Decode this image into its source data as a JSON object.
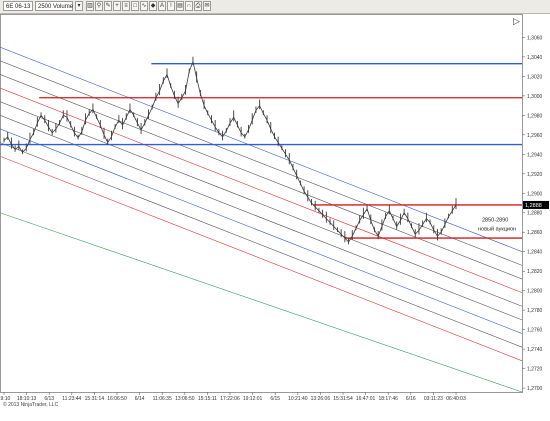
{
  "toolbar": {
    "instrument": "6E 06-13",
    "period": "2500 Volume",
    "icons": [
      "dropdown-icon",
      "chart-bar-icon",
      "zoom-icon",
      "draw-icon",
      "crosshair-icon",
      "properties-icon",
      "template-icon",
      "indicator-icon",
      "strategy-icon",
      "text-icon",
      "alert-icon",
      "data-box-icon",
      "magnet-icon",
      "print-icon",
      "email-icon",
      "expand-icon"
    ]
  },
  "copyright": "© 2013 NinjaTrader, LLC",
  "colors": {
    "price": "#3a3a3a",
    "blue_level": "#2d5fd8",
    "red_level": "#d61a1a",
    "channel_red": "#e03030",
    "channel_blue": "#3b5fc8",
    "channel_gray": "#555555",
    "channel_green": "#2f9a5a",
    "last_price_bg": "#000000"
  },
  "chart_data": {
    "type": "line",
    "series": [
      {
        "values": [
          1.2954,
          1.2958,
          1.295,
          1.2945,
          1.2948,
          1.2942,
          1.2946,
          1.2955,
          1.2962,
          1.2972,
          1.298,
          1.2975,
          1.2968,
          1.2962,
          1.2966,
          1.2972,
          1.298,
          1.2978,
          1.297,
          1.2962,
          1.2957,
          1.2963,
          1.2975,
          1.2982,
          1.2986,
          1.2978,
          1.297,
          1.296,
          1.2952,
          1.2958,
          1.2968,
          1.2975,
          1.297,
          1.2978,
          1.2986,
          1.298,
          1.2972,
          1.2965,
          1.2972,
          1.298,
          1.2988,
          1.2998,
          1.3005,
          1.3015,
          1.3022,
          1.301,
          1.3,
          1.2992,
          1.2998,
          1.3005,
          1.3025,
          1.3035,
          1.3018,
          1.3002,
          1.299,
          1.2982,
          1.2975,
          1.2968,
          1.2962,
          1.2958,
          1.2964,
          1.2972,
          1.2978,
          1.297,
          1.2962,
          1.2958,
          1.2965,
          1.2975,
          1.2985,
          1.299,
          1.2982,
          1.2975,
          1.2966,
          1.2958,
          1.2952,
          1.2946,
          1.294,
          1.2934,
          1.2926,
          1.2918,
          1.291,
          1.2902,
          1.2896,
          1.289,
          1.2886,
          1.2882,
          1.2878,
          1.2874,
          1.287,
          1.2866,
          1.2862,
          1.2858,
          1.2854,
          1.285,
          1.2856,
          1.2864,
          1.2872,
          1.2878,
          1.2884,
          1.2872,
          1.2862,
          1.2856,
          1.2866,
          1.2876,
          1.2882,
          1.2874,
          1.2866,
          1.2872,
          1.288,
          1.2874,
          1.2866,
          1.2858,
          1.2862,
          1.2868,
          1.2874,
          1.287,
          1.2862,
          1.2856,
          1.286,
          1.2868,
          1.2876,
          1.2882,
          1.2888
        ]
      }
    ],
    "xlabels": [
      "19:10",
      "18:10:13",
      "6/13",
      "11:23:44",
      "15:31:14",
      "16:06:50",
      "6/14",
      "11:06:35",
      "13:06:50",
      "15:15:11",
      "17:22:06",
      "19:12:01",
      "6/15",
      "10:21:40",
      "13:26:06",
      "15:31:54",
      "16:47:01",
      "18:17:46",
      "6/16",
      "03:11:23",
      "06:40:03"
    ],
    "yticks": [
      1.306,
      1.304,
      1.302,
      1.3,
      1.298,
      1.296,
      1.294,
      1.292,
      1.29,
      1.288,
      1.286,
      1.284,
      1.282,
      1.28,
      1.278,
      1.276,
      1.274,
      1.272,
      1.27
    ],
    "ylim": [
      1.2696,
      1.3084
    ],
    "horizontal_levels": [
      {
        "price": 1.3033,
        "color": "#2d5fd8",
        "from": 0.29
      },
      {
        "price": 1.2998,
        "color": "#d61a1a",
        "from": 0.075
      },
      {
        "price": 1.295,
        "color": "#2d5fd8",
        "from": 0.0
      },
      {
        "price": 1.2888,
        "color": "#d61a1a",
        "from": 0.6
      },
      {
        "price": 1.2854,
        "color": "#d61a1a",
        "from": 0.66
      }
    ],
    "channel_lines": [
      {
        "y_start": 1.305,
        "y_end": 1.284,
        "color": "#3b5fc8"
      },
      {
        "y_start": 1.3036,
        "y_end": 1.2826,
        "color": "#555555"
      },
      {
        "y_start": 1.3022,
        "y_end": 1.2812,
        "color": "#555555"
      },
      {
        "y_start": 1.3008,
        "y_end": 1.2798,
        "color": "#e03030"
      },
      {
        "y_start": 1.2994,
        "y_end": 1.2784,
        "color": "#555555"
      },
      {
        "y_start": 1.298,
        "y_end": 1.277,
        "color": "#555555"
      },
      {
        "y_start": 1.2966,
        "y_end": 1.2756,
        "color": "#3b5fc8"
      },
      {
        "y_start": 1.2952,
        "y_end": 1.2742,
        "color": "#555555"
      },
      {
        "y_start": 1.2938,
        "y_end": 1.2728,
        "color": "#e03030"
      },
      {
        "y_start": 1.288,
        "y_end": 1.2696,
        "color": "#2f9a5a"
      }
    ],
    "last_price": "1,2888",
    "annotation": [
      "2850-2890",
      "новый аукцион"
    ]
  }
}
